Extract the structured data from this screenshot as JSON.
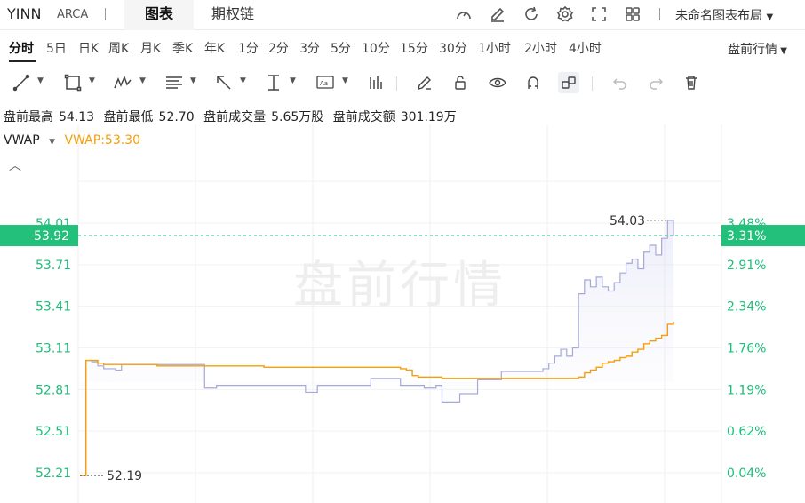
{
  "header": {
    "symbol": "YINN",
    "exchange": "ARCA",
    "tab_chart": "图表",
    "tab_options": "期权链",
    "layout_name": "未命名图表布局",
    "icons": [
      "gauge-icon",
      "edit-icon",
      "refresh-icon",
      "settings-icon",
      "fullscreen-icon",
      "grid-icon"
    ]
  },
  "periods": {
    "items": [
      "分时",
      "5日",
      "日K",
      "周K",
      "月K",
      "季K",
      "年K",
      "1分",
      "2分",
      "3分",
      "5分",
      "10分",
      "15分",
      "30分",
      "1小时",
      "2小时",
      "4小时"
    ],
    "active": "分时",
    "session_select": "盘前行情"
  },
  "stats": {
    "high_label": "盘前最高",
    "high": "54.13",
    "low_label": "盘前最低",
    "low": "52.70",
    "vol_label": "盘前成交量",
    "vol": "5.65万股",
    "amt_label": "盘前成交额",
    "amt": "301.19万"
  },
  "indicator": {
    "name": "VWAP",
    "value_text": "VWAP:53.30"
  },
  "watermark": "盘前行情",
  "colors": {
    "price": "#a5a8d8",
    "vwap": "#f59e0b",
    "up": "#1fbd7a",
    "last": "#22c07a"
  },
  "chart_data": {
    "type": "line",
    "ylim": [
      52.18,
      54.15
    ],
    "y_ticks_left": [
      "54.01",
      "53.71",
      "53.41",
      "53.11",
      "52.81",
      "52.51",
      "52.21"
    ],
    "y_ticks_left_values": [
      54.01,
      53.71,
      53.41,
      53.11,
      52.81,
      52.51,
      52.21
    ],
    "y_ticks_right": [
      "3.48%",
      "2.91%",
      "2.34%",
      "1.76%",
      "1.19%",
      "0.62%",
      "0.04%"
    ],
    "last_price": "53.92",
    "last_price_value": 53.92,
    "last_pct": "3.31%",
    "max_label": "54.03",
    "max_value": 54.03,
    "min_label": "52.19",
    "min_value": 52.19,
    "series": [
      {
        "name": "price",
        "x": [
          0,
          1,
          2,
          3,
          4,
          5,
          6,
          7,
          8,
          9,
          10,
          11,
          12,
          13,
          14,
          15,
          16,
          17,
          18,
          19,
          20,
          21,
          22,
          23,
          24,
          25,
          26,
          27,
          28,
          29,
          30,
          31,
          32,
          33,
          34,
          35,
          36,
          37,
          38,
          39,
          40,
          41,
          42,
          43,
          44,
          45,
          46,
          47,
          48,
          49,
          50,
          51,
          52,
          53,
          54,
          55,
          56,
          57,
          58,
          59,
          60,
          61,
          62,
          63,
          64,
          65,
          66,
          67,
          68,
          69,
          70,
          71,
          72,
          73,
          74,
          75,
          76,
          77,
          78,
          79,
          80,
          81,
          82,
          83,
          84,
          85,
          86,
          87,
          88,
          89,
          90,
          91,
          92,
          93,
          94,
          95,
          96,
          97,
          98,
          99,
          100
        ],
        "values": [
          52.19,
          53.02,
          53.01,
          52.98,
          52.96,
          52.96,
          52.95,
          52.99,
          52.99,
          52.99,
          52.99,
          52.99,
          52.99,
          52.99,
          52.99,
          52.99,
          52.99,
          52.99,
          52.99,
          52.99,
          52.99,
          52.82,
          52.82,
          52.84,
          52.84,
          52.84,
          52.84,
          52.84,
          52.84,
          52.84,
          52.84,
          52.84,
          52.84,
          52.84,
          52.84,
          52.84,
          52.84,
          52.84,
          52.79,
          52.79,
          52.84,
          52.84,
          52.84,
          52.84,
          52.84,
          52.84,
          52.84,
          52.84,
          52.84,
          52.89,
          52.89,
          52.89,
          52.89,
          52.89,
          52.84,
          52.84,
          52.84,
          52.84,
          52.82,
          52.82,
          52.84,
          52.72,
          52.72,
          52.72,
          52.78,
          52.78,
          52.78,
          52.88,
          52.88,
          52.88,
          52.88,
          52.94,
          52.94,
          52.94,
          52.94,
          52.94,
          52.94,
          52.94,
          52.96,
          53.0,
          53.05,
          53.1,
          53.05,
          53.11,
          53.5,
          53.6,
          53.55,
          53.62,
          53.55,
          53.52,
          53.58,
          53.65,
          53.72,
          53.75,
          53.68,
          53.8,
          53.85,
          53.78,
          53.9,
          54.03,
          53.92
        ]
      },
      {
        "name": "VWAP",
        "x": [
          0,
          1,
          2,
          3,
          4,
          5,
          6,
          7,
          8,
          9,
          10,
          11,
          12,
          13,
          14,
          15,
          16,
          17,
          18,
          19,
          20,
          21,
          22,
          23,
          24,
          25,
          26,
          27,
          28,
          29,
          30,
          31,
          32,
          33,
          34,
          35,
          36,
          37,
          38,
          39,
          40,
          41,
          42,
          43,
          44,
          45,
          46,
          47,
          48,
          49,
          50,
          51,
          52,
          53,
          54,
          55,
          56,
          57,
          58,
          59,
          60,
          61,
          62,
          63,
          64,
          65,
          66,
          67,
          68,
          69,
          70,
          71,
          72,
          73,
          74,
          75,
          76,
          77,
          78,
          79,
          80,
          81,
          82,
          83,
          84,
          85,
          86,
          87,
          88,
          89,
          90,
          91,
          92,
          93,
          94,
          95,
          96,
          97,
          98,
          99,
          100
        ],
        "values": [
          52.19,
          53.02,
          53.02,
          53.0,
          52.99,
          52.99,
          52.99,
          52.99,
          52.99,
          52.99,
          52.99,
          52.99,
          52.99,
          52.98,
          52.98,
          52.98,
          52.98,
          52.98,
          52.98,
          52.98,
          52.98,
          52.98,
          52.98,
          52.98,
          52.98,
          52.98,
          52.98,
          52.98,
          52.98,
          52.98,
          52.98,
          52.97,
          52.97,
          52.97,
          52.97,
          52.97,
          52.97,
          52.97,
          52.97,
          52.97,
          52.97,
          52.97,
          52.97,
          52.97,
          52.97,
          52.97,
          52.97,
          52.97,
          52.97,
          52.97,
          52.97,
          52.97,
          52.97,
          52.97,
          52.96,
          52.95,
          52.91,
          52.9,
          52.9,
          52.9,
          52.9,
          52.89,
          52.89,
          52.89,
          52.89,
          52.89,
          52.89,
          52.89,
          52.89,
          52.89,
          52.89,
          52.89,
          52.89,
          52.89,
          52.89,
          52.89,
          52.89,
          52.89,
          52.89,
          52.89,
          52.89,
          52.89,
          52.89,
          52.89,
          52.9,
          52.93,
          52.95,
          52.97,
          53.0,
          53.01,
          53.02,
          53.04,
          53.05,
          53.08,
          53.1,
          53.14,
          53.16,
          53.18,
          53.2,
          53.28,
          53.3
        ]
      }
    ]
  }
}
